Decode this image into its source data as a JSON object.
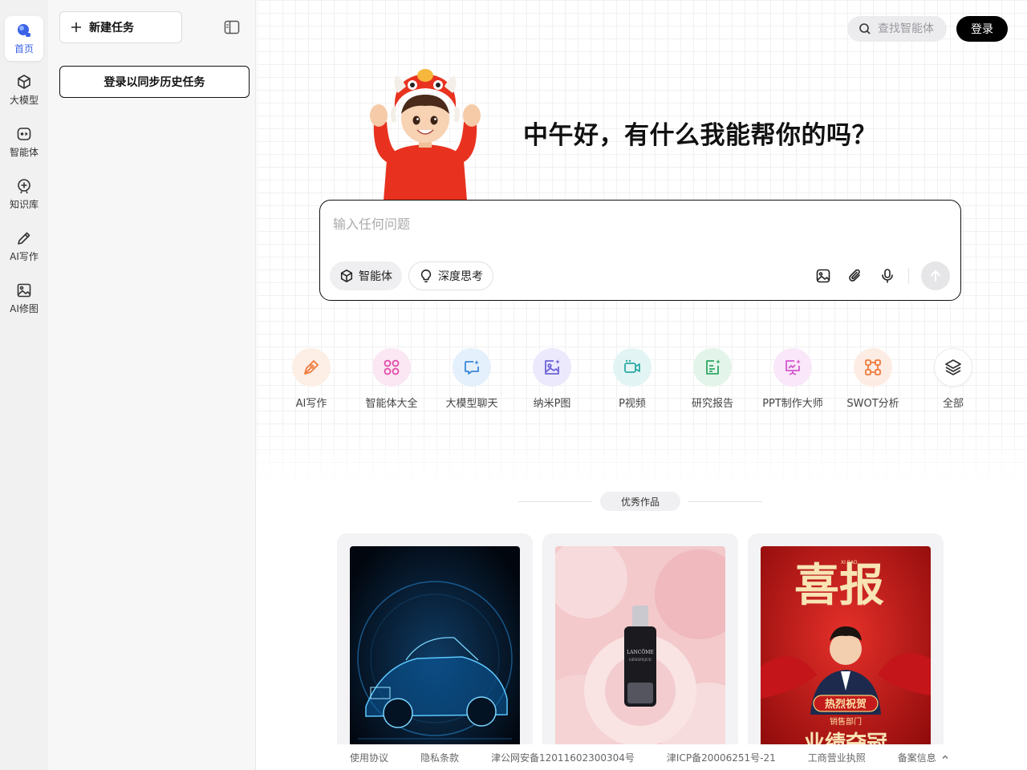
{
  "rail": {
    "items": [
      {
        "label": "首页",
        "icon": "home-sphere-icon",
        "active": true
      },
      {
        "label": "大模型",
        "icon": "cube-icon"
      },
      {
        "label": "智能体",
        "icon": "agent-icon"
      },
      {
        "label": "知识库",
        "icon": "knowledge-icon"
      },
      {
        "label": "AI写作",
        "icon": "pen-icon"
      },
      {
        "label": "AI修图",
        "icon": "image-icon"
      }
    ]
  },
  "panel": {
    "new_task": "新建任务",
    "login_sync": "登录以同步历史任务"
  },
  "header": {
    "search_placeholder": "查找智能体",
    "login": "登录"
  },
  "hero": {
    "greeting": "中午好，有什么我能帮你的吗？"
  },
  "chat": {
    "placeholder": "输入任何问题",
    "chip_agent": "智能体",
    "chip_think": "深度思考"
  },
  "features": [
    {
      "label": "AI写作",
      "icon": "pen-nib-icon",
      "color": "#f07a3b",
      "bg": "#fdeee6"
    },
    {
      "label": "智能体大全",
      "icon": "grid-circles-icon",
      "color": "#e14aa8",
      "bg": "#fbe7f3"
    },
    {
      "label": "大模型聊天",
      "icon": "chat-sparkle-icon",
      "color": "#3a86d9",
      "bg": "#e4f0fb"
    },
    {
      "label": "纳米P图",
      "icon": "photo-sparkle-icon",
      "color": "#6d63d9",
      "bg": "#ebe9fb"
    },
    {
      "label": "P视频",
      "icon": "video-icon",
      "color": "#2aa9a4",
      "bg": "#e2f5f4"
    },
    {
      "label": "研究报告",
      "icon": "report-icon",
      "color": "#2fa765",
      "bg": "#e3f5ea"
    },
    {
      "label": "PPT制作大师",
      "icon": "presentation-icon",
      "color": "#d457d0",
      "bg": "#fae7f9"
    },
    {
      "label": "SWOT分析",
      "icon": "nodes-icon",
      "color": "#ee7a3c",
      "bg": "#fdece4"
    },
    {
      "label": "全部",
      "icon": "layers-icon",
      "color": "#333333",
      "bg": "#ffffff"
    }
  ],
  "works": {
    "title": "优秀作品",
    "cards": [
      {
        "name": "car-hologram"
      },
      {
        "name": "serum-peony",
        "brand": "LANCÔME",
        "product": "GÉNIFIQUE"
      },
      {
        "name": "good-news-poster",
        "headline": "喜报",
        "pinyin": "XI BAO",
        "badge": "热烈祝贺",
        "dept": "销售部门",
        "bottom": "业绩夺冠"
      }
    ]
  },
  "footer": {
    "links": [
      "使用协议",
      "隐私条款",
      "津公网安备12011602300304号",
      "津ICP备20006251号-21",
      "工商营业执照",
      "备案信息"
    ]
  }
}
